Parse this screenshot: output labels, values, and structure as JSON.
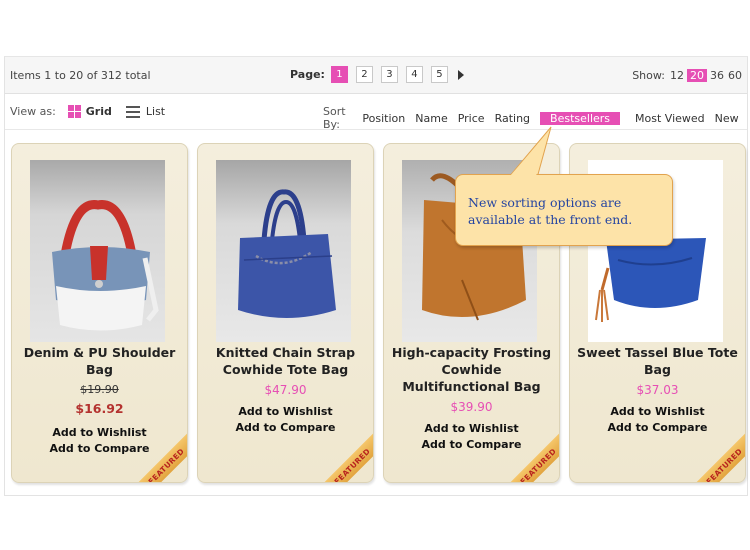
{
  "toolbar": {
    "items_total": "Items 1 to 20 of 312 total",
    "pager": {
      "label": "Page:",
      "pages": [
        "1",
        "2",
        "3",
        "4",
        "5"
      ],
      "current": "1"
    },
    "show": {
      "label": "Show:",
      "options": [
        "12",
        "20",
        "36",
        "60"
      ],
      "current": "20"
    }
  },
  "view": {
    "label": "View as:",
    "grid_label": "Grid",
    "list_label": "List",
    "current": "Grid",
    "grid_icon": "grid-icon",
    "list_icon": "list-icon"
  },
  "sort": {
    "label": "Sort By:",
    "options": [
      "Position",
      "Name",
      "Price",
      "Rating",
      "Bestsellers",
      "Most Viewed",
      "New"
    ],
    "current": "Bestsellers",
    "direction_icon": "arrow-down-icon"
  },
  "callout": {
    "text": "New sorting options are available at the front end."
  },
  "products": [
    {
      "name": "Denim & PU Shoulder Bag",
      "old_price": "$19.90",
      "price": "$16.92",
      "on_sale": true,
      "wishlist": "Add to Wishlist",
      "compare": "Add to Compare",
      "badge": "FEATURED"
    },
    {
      "name": "Knitted Chain Strap Cowhide Tote Bag",
      "price": "$47.90",
      "on_sale": false,
      "wishlist": "Add to Wishlist",
      "compare": "Add to Compare",
      "badge": "FEATURED"
    },
    {
      "name": "High-capacity Frosting Cowhide Multifunctional Bag",
      "price": "$39.90",
      "on_sale": false,
      "wishlist": "Add to Wishlist",
      "compare": "Add to Compare",
      "badge": "FEATURED"
    },
    {
      "name": "Sweet Tassel Blue Tote Bag",
      "price": "$37.03",
      "on_sale": false,
      "wishlist": "Add to Wishlist",
      "compare": "Add to Compare",
      "badge": "FEATURED"
    }
  ],
  "colors": {
    "accent": "#e64fb4",
    "sale_price": "#b4322f",
    "card_bg": "#f4eedd",
    "callout_bg": "#fde3a8",
    "callout_text": "#2545a1"
  }
}
